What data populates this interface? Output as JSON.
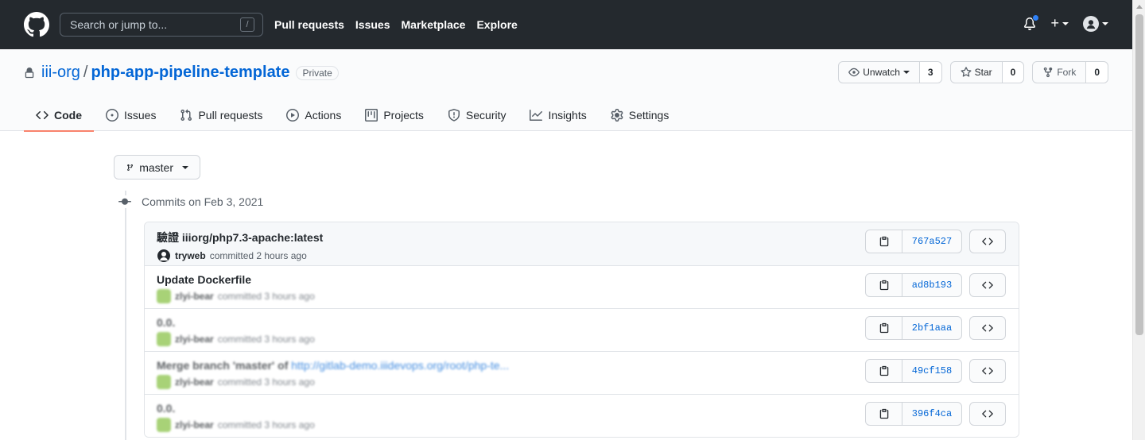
{
  "header": {
    "search_placeholder": "Search or jump to...",
    "search_shortcut": "/",
    "nav": [
      "Pull requests",
      "Issues",
      "Marketplace",
      "Explore"
    ],
    "plus_label": "+"
  },
  "repo": {
    "owner": "iii-org",
    "separator": "/",
    "name": "php-app-pipeline-template",
    "visibility": "Private",
    "watch_label": "Unwatch",
    "watch_count": "3",
    "star_label": "Star",
    "star_count": "0",
    "fork_label": "Fork",
    "fork_count": "0"
  },
  "tabs": [
    {
      "label": "Code",
      "icon": "code-icon",
      "selected": true
    },
    {
      "label": "Issues",
      "icon": "issue-icon",
      "selected": false
    },
    {
      "label": "Pull requests",
      "icon": "pull-request-icon",
      "selected": false
    },
    {
      "label": "Actions",
      "icon": "play-icon",
      "selected": false
    },
    {
      "label": "Projects",
      "icon": "project-icon",
      "selected": false
    },
    {
      "label": "Security",
      "icon": "shield-icon",
      "selected": false
    },
    {
      "label": "Insights",
      "icon": "graph-icon",
      "selected": false
    },
    {
      "label": "Settings",
      "icon": "gear-icon",
      "selected": false
    }
  ],
  "branch": {
    "name": "master"
  },
  "commits_group": {
    "heading": "Commits on Feb 3, 2021"
  },
  "commits": [
    {
      "message": "驗證 iiiorg/php7.3-apache:latest",
      "link_text": "",
      "author": "tryweb",
      "time": "committed 2 hours ago",
      "sha": "767a527",
      "blurred_message": false,
      "blurred_meta": false
    },
    {
      "message": "Update Dockerfile",
      "link_text": "",
      "author": "zlyi-bear",
      "time": "committed 3 hours ago",
      "sha": "ad8b193",
      "blurred_message": false,
      "blurred_meta": true
    },
    {
      "message": "0.0.",
      "link_text": "",
      "author": "zlyi-bear",
      "time": "committed 3 hours ago",
      "sha": "2bf1aaa",
      "blurred_message": true,
      "blurred_meta": true
    },
    {
      "message": "Merge branch 'master' of ",
      "link_text": "http://gitlab-demo.iiidevops.org/root/php-te...",
      "author": "zlyi-bear",
      "time": "committed 3 hours ago",
      "sha": "49cf158",
      "blurred_message": true,
      "blurred_meta": true
    },
    {
      "message": "0.0.",
      "link_text": "",
      "author": "zlyi-bear",
      "time": "committed 3 hours ago",
      "sha": "396f4ca",
      "blurred_message": true,
      "blurred_meta": true
    }
  ],
  "colors": {
    "header_bg": "#24292e",
    "link": "#0366d6",
    "selected_tab_underline": "#f9826c",
    "notification_dot": "#2f81f7"
  }
}
